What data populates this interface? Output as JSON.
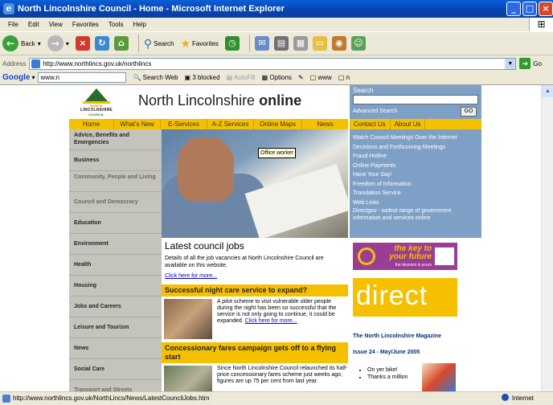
{
  "window": {
    "title": "North Lincolnshire Council - Home - Microsoft Internet Explorer",
    "icon": "ie-icon",
    "controls": [
      "_",
      "□",
      "×"
    ]
  },
  "menu": [
    "File",
    "Edit",
    "View",
    "Favorites",
    "Tools",
    "Help"
  ],
  "toolbar": {
    "back": "Back",
    "search": "Search",
    "favorites": "Favorites"
  },
  "address": {
    "label": "Address",
    "url": "http://www.northlincs.gov.uk/northlincs",
    "go": "Go"
  },
  "googlebar": {
    "logo": "Google",
    "query": "www.n",
    "search_web": "Search Web",
    "blocked": "3 blocked",
    "autofill": "AutoFill",
    "options": "Options",
    "www": "www",
    "n": "n"
  },
  "site": {
    "logo_text": "LINCOLNSHIRE",
    "logo_top": "NORTH",
    "logo_bottom": "COUNCIL",
    "title_plain": "North Lincolnshire ",
    "title_bold": "online",
    "nav": [
      "Home",
      "What's New",
      "E-Services",
      "A-Z Services",
      "Online Maps",
      "News"
    ],
    "left_menu": [
      {
        "label": "Advice, Benefits and Emergencies",
        "dim": false
      },
      {
        "label": "Business",
        "dim": false
      },
      {
        "label": "Community, People and Living",
        "dim": true
      },
      {
        "label": "Council and Democracy",
        "dim": true
      },
      {
        "label": "Education",
        "dim": false
      },
      {
        "label": "Environment",
        "dim": false
      },
      {
        "label": "Health",
        "dim": false
      },
      {
        "label": "Housing",
        "dim": false
      },
      {
        "label": "Jobs and Careers",
        "dim": false
      },
      {
        "label": "Leisure and Tourism",
        "dim": false
      },
      {
        "label": "News",
        "dim": false
      },
      {
        "label": "Social Care",
        "dim": false
      },
      {
        "label": "Transport and Streets",
        "dim": true
      }
    ],
    "tooltip": "Office worker",
    "jobs": {
      "title": "Latest council jobs",
      "text": "Details of all the job vacancies at North Lincolnshire Council are available on this website.",
      "link": "Click here for more..."
    },
    "story1": {
      "title": "Successful night care service to expand?",
      "text": "A pilot scheme to visit vulnerable older people during the night has been so successful that the service is not only going to continue, it could be expanded.",
      "link": "Click here for more..."
    },
    "story2": {
      "title": "Concessionary fares campaign gets off to a flying start",
      "text": "Since North Lincolnshire Council relaunched its half-price concessionary fares scheme just weeks ago, figures are up 75 per cent from last year."
    },
    "search": {
      "label": "Search",
      "advanced": "Advanced Search",
      "go": "GO"
    },
    "right_nav": [
      "Contact Us",
      "About Us"
    ],
    "right_links": [
      "Watch Council Meetings Over the Internet",
      "Decisions and Forthcoming Meetings",
      "Fraud Hotline",
      "Online Payments",
      "Have Your Say!",
      "Freedom of Information",
      "Translation Service",
      "Web Links",
      "Directgov - widest range of government information and services online"
    ],
    "key_banner": {
      "line1": "the key to",
      "line2": "your future",
      "sub": "the decision is yours"
    },
    "direct": "direct",
    "magazine": "The North Lincolnshire Magazine",
    "issue": "Issue 24 - May/June 2005",
    "bullets": [
      "On yer bike!",
      "Thanks a million"
    ]
  },
  "status": {
    "url": "http://www.northlincs.gov.uk/NorthLincs/News/LatestCouncilJobs.htm",
    "zone": "Internet"
  },
  "colors": {
    "accent_yellow": "#f5c000",
    "nav_blue": "#7fa0c6",
    "left_grey": "#c4c4bc",
    "title_blue": "#0842b0"
  }
}
